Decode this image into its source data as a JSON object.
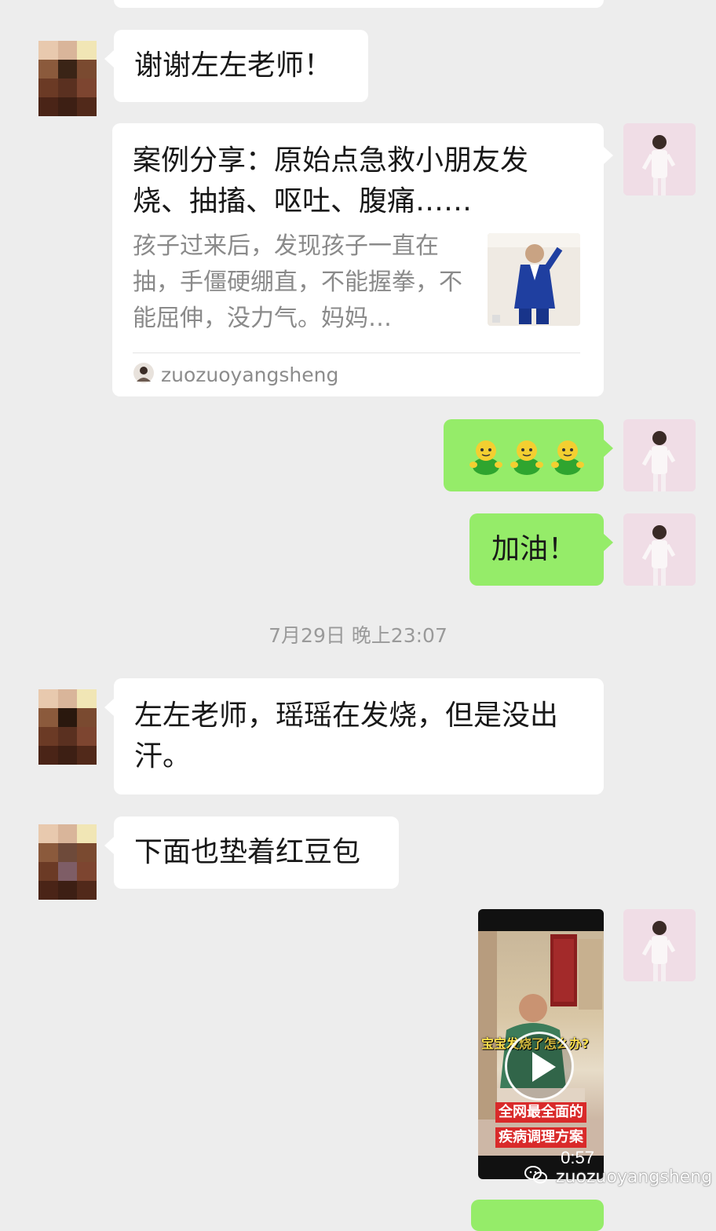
{
  "messages": {
    "thanks": "谢谢左左老师！",
    "link_title": "案例分享：原始点急救小朋友发烧、抽搐、呕吐、腹痛……",
    "link_desc": "孩子过来后，发现孩子一直在抽，手僵硬绷直，不能握拳，不能屈伸，没力气。妈妈…",
    "link_source": "zuozuoyangsheng",
    "cheer": "加油！",
    "timestamp": "7月29日 晚上23:07",
    "fever": "左左老师，瑶瑶在发烧，但是没出汗。",
    "bean_bag": "下面也垫着红豆包"
  },
  "video": {
    "caption_1": "宝宝发烧了怎么办?",
    "caption_2": "全网最全面的",
    "caption_3": "疾病调理方案",
    "duration": "0:57"
  },
  "watermark": "zuozuoyangsheng",
  "icons": {
    "avatar_user": "pixelated-avatar",
    "avatar_teacher": "teacher-photo-avatar",
    "emoji": "green-sprout-emoji",
    "play": "play-icon",
    "source": "source-avatar-icon",
    "watermark": "wechat-icon"
  },
  "colors": {
    "background": "#ededed",
    "bubble_sent": "#95ec69",
    "bubble_received": "#ffffff"
  }
}
